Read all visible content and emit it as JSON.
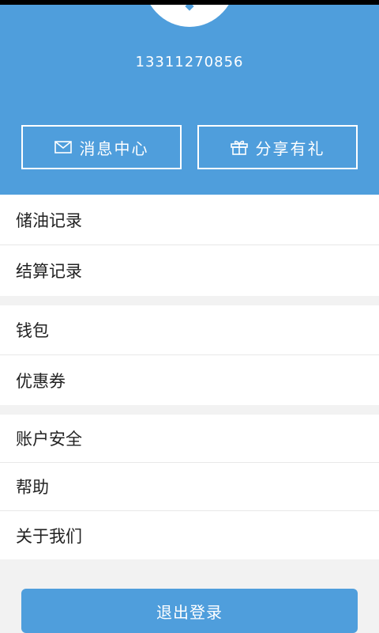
{
  "profile": {
    "phone": "13311270856"
  },
  "header_buttons": {
    "messages": {
      "label": "消息中心",
      "icon": "mail-icon"
    },
    "share": {
      "label": "分享有礼",
      "icon": "gift-icon"
    }
  },
  "menu": {
    "group1": [
      {
        "label": "储油记录"
      },
      {
        "label": "结算记录"
      }
    ],
    "group2": [
      {
        "label": "钱包"
      },
      {
        "label": "优惠券"
      }
    ],
    "group3": [
      {
        "label": "账户安全"
      },
      {
        "label": "帮助"
      },
      {
        "label": "关于我们"
      }
    ]
  },
  "logout": {
    "label": "退出登录"
  },
  "colors": {
    "primary": "#4f9edc",
    "background": "#f2f2f2",
    "text": "#222222"
  }
}
